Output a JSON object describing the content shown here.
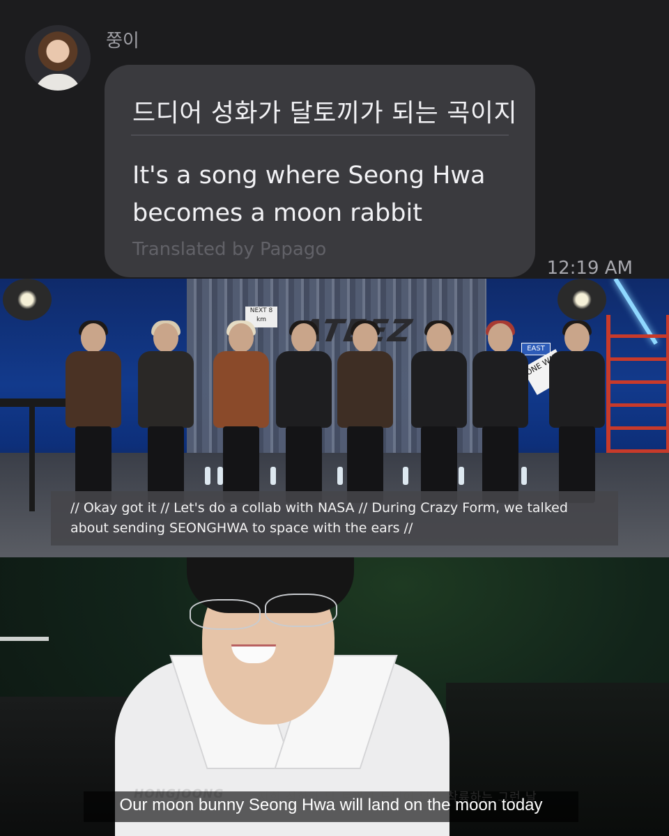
{
  "chat": {
    "sender_name": "쭝이",
    "message_original": "드디어 성화가 달토끼가 되는 곡이지",
    "message_translated": "It's a song where Seong Hwa becomes a moon rabbit",
    "translation_credit": "Translated by Papago",
    "timestamp": "12:19 AM"
  },
  "frame1": {
    "subtitle": "// Okay got it // Let's do a collab with NASA // During Crazy Form, we talked about sending SEONGHWA to space with the ears //",
    "sign_next": "NEXT 8 km",
    "sign_east": "EAST",
    "sign_oneway": "ONE WAY",
    "wall_logo": "ATEEZ"
  },
  "frame2": {
    "name_caption": "HONGJOONG",
    "korean_caption": "저희 성화가 달 토끼가 드디어 달에 착륙하는 그런 날",
    "english_caption": "Our moon bunny Seong Hwa will land on the moon today"
  },
  "colors": {
    "background": "#1c1c1e",
    "bubble": "#3a3a3e",
    "studio_blue": "#123a8c"
  }
}
